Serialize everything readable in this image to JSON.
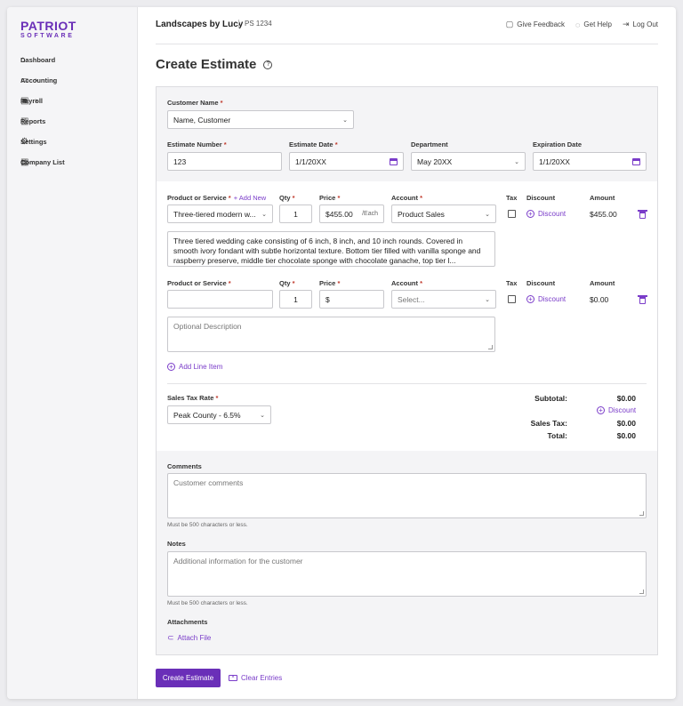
{
  "logo": {
    "line1": "PATRIOT",
    "line2": "SOFTWARE"
  },
  "sidebar": {
    "items": [
      {
        "label": "Dashboard",
        "icon": "home-icon"
      },
      {
        "label": "Accounting",
        "icon": "book-icon",
        "has_chevron": true
      },
      {
        "label": "Payroll",
        "icon": "money-icon",
        "has_chevron": true
      },
      {
        "label": "Reports",
        "icon": "chart-icon"
      },
      {
        "label": "Settings",
        "icon": "gear-icon"
      },
      {
        "label": "Company List",
        "icon": "building-icon"
      }
    ]
  },
  "header": {
    "company": "Landscapes by Lucy",
    "company_id": "PS 1234",
    "links": [
      {
        "label": "Give Feedback",
        "icon": "chat-icon"
      },
      {
        "label": "Get Help",
        "icon": "help-circle-icon"
      },
      {
        "label": "Log Out",
        "icon": "logout-icon"
      }
    ]
  },
  "page": {
    "title": "Create Estimate"
  },
  "form": {
    "customer_label": "Customer Name",
    "customer_value": "Name, Customer",
    "estimate_number_label": "Estimate Number",
    "estimate_number_value": "123",
    "estimate_date_label": "Estimate Date",
    "estimate_date_value": "1/1/20XX",
    "department_label": "Department",
    "department_value": "May 20XX",
    "expiration_label": "Expiration Date",
    "expiration_value": "1/1/20XX",
    "required_mark": "*"
  },
  "line_items": {
    "add_new": "+ Add New",
    "headers": {
      "product": "Product or Service",
      "qty": "Qty",
      "price": "Price",
      "account": "Account",
      "tax": "Tax",
      "discount": "Discount",
      "amount": "Amount"
    },
    "discount_link": "Discount",
    "rows": [
      {
        "product": "Three-tiered modern w...",
        "qty": "1",
        "price": "$455.00",
        "price_suffix": "/Each",
        "account": "Product Sales",
        "amount": "$455.00",
        "description": "Three tiered wedding cake consisting of 6 inch, 8 inch, and 10 inch rounds. Covered in smooth ivory fondant with subtle horizontal texture. Bottom tier filled with vanilla sponge and raspberry preserve, middle tier chocolate sponge with chocolate ganache, top tier l..."
      },
      {
        "product": "",
        "qty": "1",
        "price": "$",
        "account_placeholder": "Select...",
        "amount": "$0.00",
        "description_placeholder": "Optional Description"
      }
    ],
    "add_line": "Add Line Item"
  },
  "tax": {
    "label": "Sales Tax Rate",
    "value": "Peak County - 6.5%"
  },
  "totals": {
    "subtotal_label": "Subtotal:",
    "subtotal_value": "$0.00",
    "discount_link": "Discount",
    "sales_tax_label": "Sales Tax:",
    "sales_tax_value": "$0.00",
    "total_label": "Total:",
    "total_value": "$0.00"
  },
  "comments": {
    "label": "Comments",
    "placeholder": "Customer comments",
    "hint": "Must be 500 characters or less."
  },
  "notes": {
    "label": "Notes",
    "placeholder": "Additional information for the customer",
    "hint": "Must be 500 characters or less."
  },
  "attachments": {
    "label": "Attachments",
    "link": "Attach File"
  },
  "actions": {
    "create": "Create Estimate",
    "clear": "Clear Entries"
  },
  "colors": {
    "accent": "#6a2fb8",
    "link": "#7a3cc9"
  }
}
